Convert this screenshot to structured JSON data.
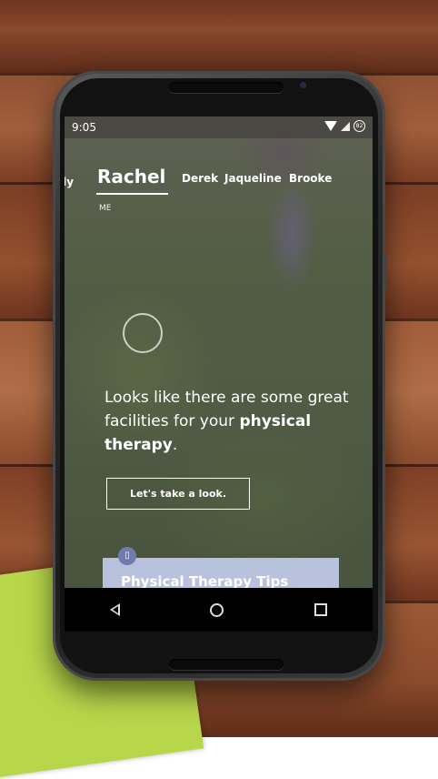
{
  "status_bar": {
    "time": "9:05",
    "battery_text": "82"
  },
  "tabs": [
    {
      "label": "ily"
    },
    {
      "label": "Rachel",
      "active": true
    },
    {
      "label": "Derek"
    },
    {
      "label": "Jaqueline"
    },
    {
      "label": "Brooke"
    }
  ],
  "profile_sub_label": "ME",
  "headline": {
    "text_before": "Looks like there are some great facilities for your",
    "emphasis": "physical therapy",
    "text_after": "."
  },
  "cta_label": "Let's take a look.",
  "card": {
    "icon_text": "▯",
    "title": "Physical Therapy Tips"
  },
  "nav_bar": {
    "back_icon": "back-triangle-icon",
    "home_icon": "home-circle-icon",
    "recents_icon": "recents-square-icon"
  },
  "colors": {
    "card_background": "#b9c2dd",
    "card_icon": "#6f7aae",
    "side_paper": "#b8d64a"
  }
}
